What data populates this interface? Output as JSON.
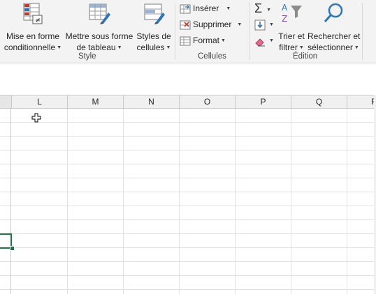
{
  "ribbon": {
    "style_group": {
      "label": "Style",
      "conditional_format": {
        "line1": "Mise en forme",
        "line2": "conditionnelle"
      },
      "format_as_table": {
        "line1": "Mettre sous forme",
        "line2": "de tableau"
      },
      "cell_styles": {
        "line1": "Styles de",
        "line2": "cellules"
      }
    },
    "cells_group": {
      "label": "Cellules",
      "insert": "Insérer",
      "delete": "Supprimer",
      "format": "Format"
    },
    "editing_group": {
      "label": "Édition",
      "sort_filter": {
        "line1": "Trier et",
        "line2": "filtrer"
      },
      "find_select": {
        "line1": "Rechercher et",
        "line2": "sélectionner"
      }
    }
  },
  "grid": {
    "columns": [
      "L",
      "M",
      "N",
      "O",
      "P",
      "Q",
      "R"
    ]
  },
  "colors": {
    "accent_green": "#217346",
    "ribbon_bg": "#f3f3f3",
    "gridline": "#e1e1e1"
  },
  "icons": [
    "conditional-format-icon",
    "table-format-icon",
    "cell-styles-icon",
    "insert-cells-icon",
    "delete-cells-icon",
    "format-cells-icon",
    "autosum-icon",
    "fill-icon",
    "clear-icon",
    "sort-filter-icon",
    "find-icon",
    "plus-cursor-icon"
  ]
}
